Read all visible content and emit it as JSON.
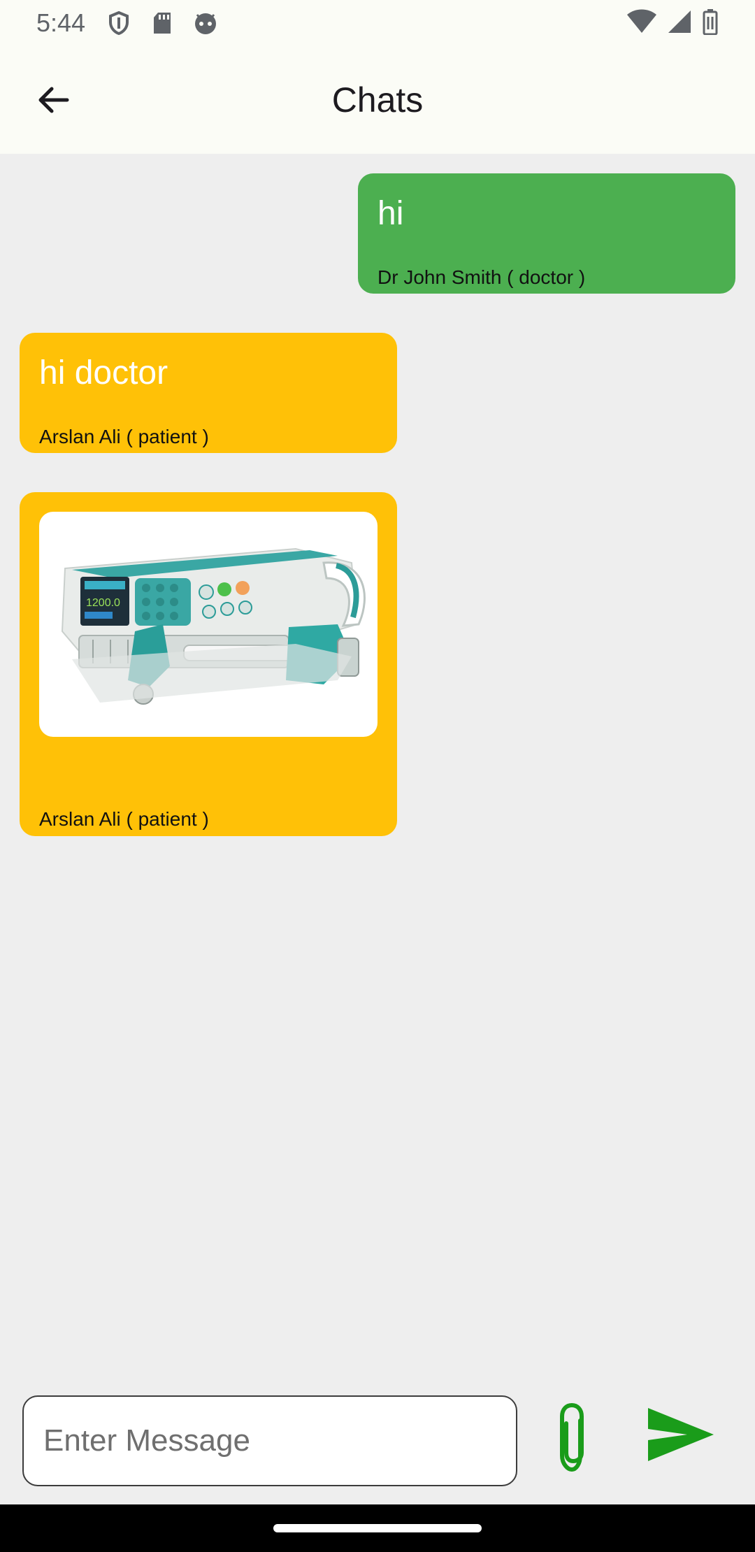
{
  "status_bar": {
    "time": "5:44",
    "left_icons": [
      "shield-icon",
      "sd-card-icon",
      "android-face-icon"
    ],
    "right_icons": [
      "wifi-icon",
      "cell-signal-icon",
      "battery-icon"
    ]
  },
  "app_bar": {
    "title": "Chats",
    "back_icon": "arrow-back-icon"
  },
  "messages": [
    {
      "type": "text",
      "direction": "sent",
      "text": "hi",
      "sender": "Dr John Smith ( doctor )",
      "color": "#4caf50"
    },
    {
      "type": "text",
      "direction": "received",
      "text": "hi doctor",
      "sender": "Arslan Ali ( patient )",
      "color": "#ffc107"
    },
    {
      "type": "image",
      "direction": "received",
      "image": "syringe-pump-photo",
      "sender": "Arslan Ali ( patient )",
      "color": "#ffc107"
    }
  ],
  "composer": {
    "placeholder": "Enter Message",
    "value": "",
    "attach_icon": "paperclip-icon",
    "send_icon": "send-icon",
    "accent_color": "#1a9c1a"
  }
}
